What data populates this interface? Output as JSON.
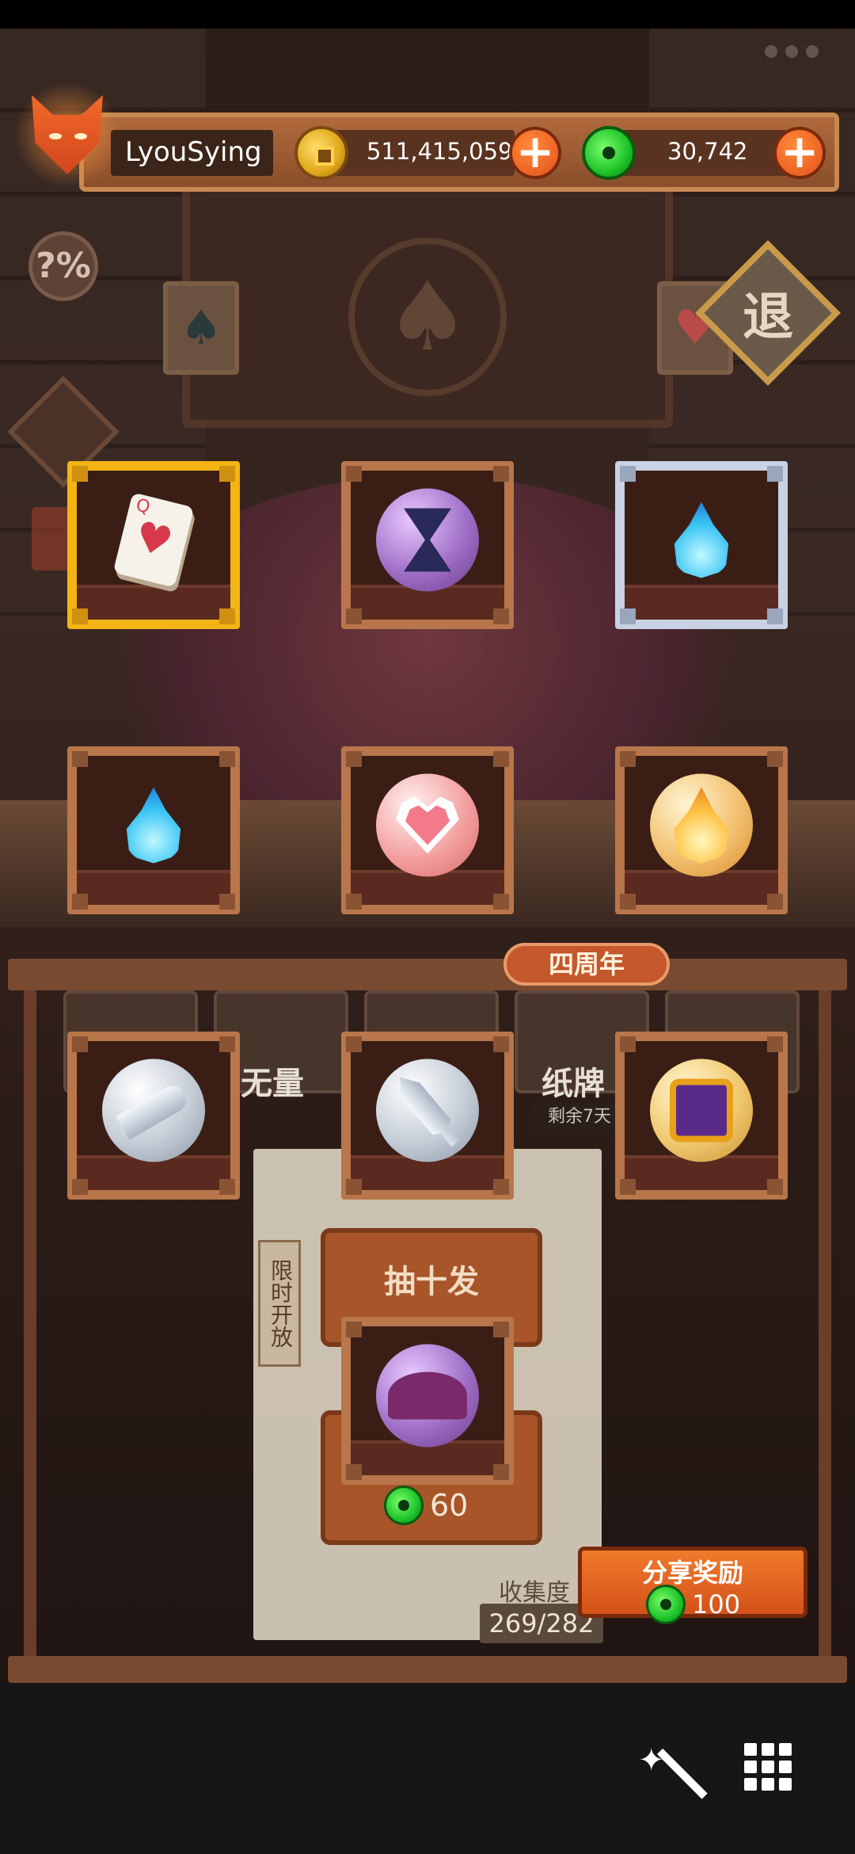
{
  "player": {
    "name": "LyouSying"
  },
  "currency": {
    "gold": "511,415,059",
    "jade": "30,742"
  },
  "top_buttons": {
    "retreat_label": "退",
    "help_label": "?%"
  },
  "grid_items": [
    {
      "frame": "gold",
      "icon": "playing-card-q-hearts-icon"
    },
    {
      "frame": "bronze",
      "icon": "hourglass-orb-icon"
    },
    {
      "frame": "silver",
      "icon": "blue-flame-icon"
    },
    {
      "frame": "bronze",
      "icon": "blue-flame-icon"
    },
    {
      "frame": "bronze",
      "icon": "heart-orb-icon"
    },
    {
      "frame": "bronze",
      "icon": "fire-orb-icon"
    },
    {
      "frame": "bronze",
      "icon": "cleaver-orb-icon"
    },
    {
      "frame": "bronze",
      "icon": "sword-orb-icon"
    },
    {
      "frame": "bronze",
      "icon": "mask-orb-icon"
    },
    {
      "frame": "bronze",
      "icon": "hat-orb-icon"
    }
  ],
  "card_glyph": {
    "rank": "Q",
    "suit": "♥"
  },
  "lower": {
    "anniversary_tag": "四周年",
    "mode_wuliang": "无量",
    "mode_zhipai": "纸牌",
    "remaining": "剩余7天",
    "limited_open": "限时开放",
    "draw_ten_label": "抽十发",
    "draw_price": "60",
    "collection_label": "收集度",
    "collection_count": "269/282",
    "share_label": "分享奖励",
    "share_price": "100"
  },
  "colors": {
    "gold_frame": "#f3b414",
    "silver_frame": "#c8d2e4",
    "bronze_frame": "#b8764a",
    "accent_orange": "#e3521a"
  }
}
